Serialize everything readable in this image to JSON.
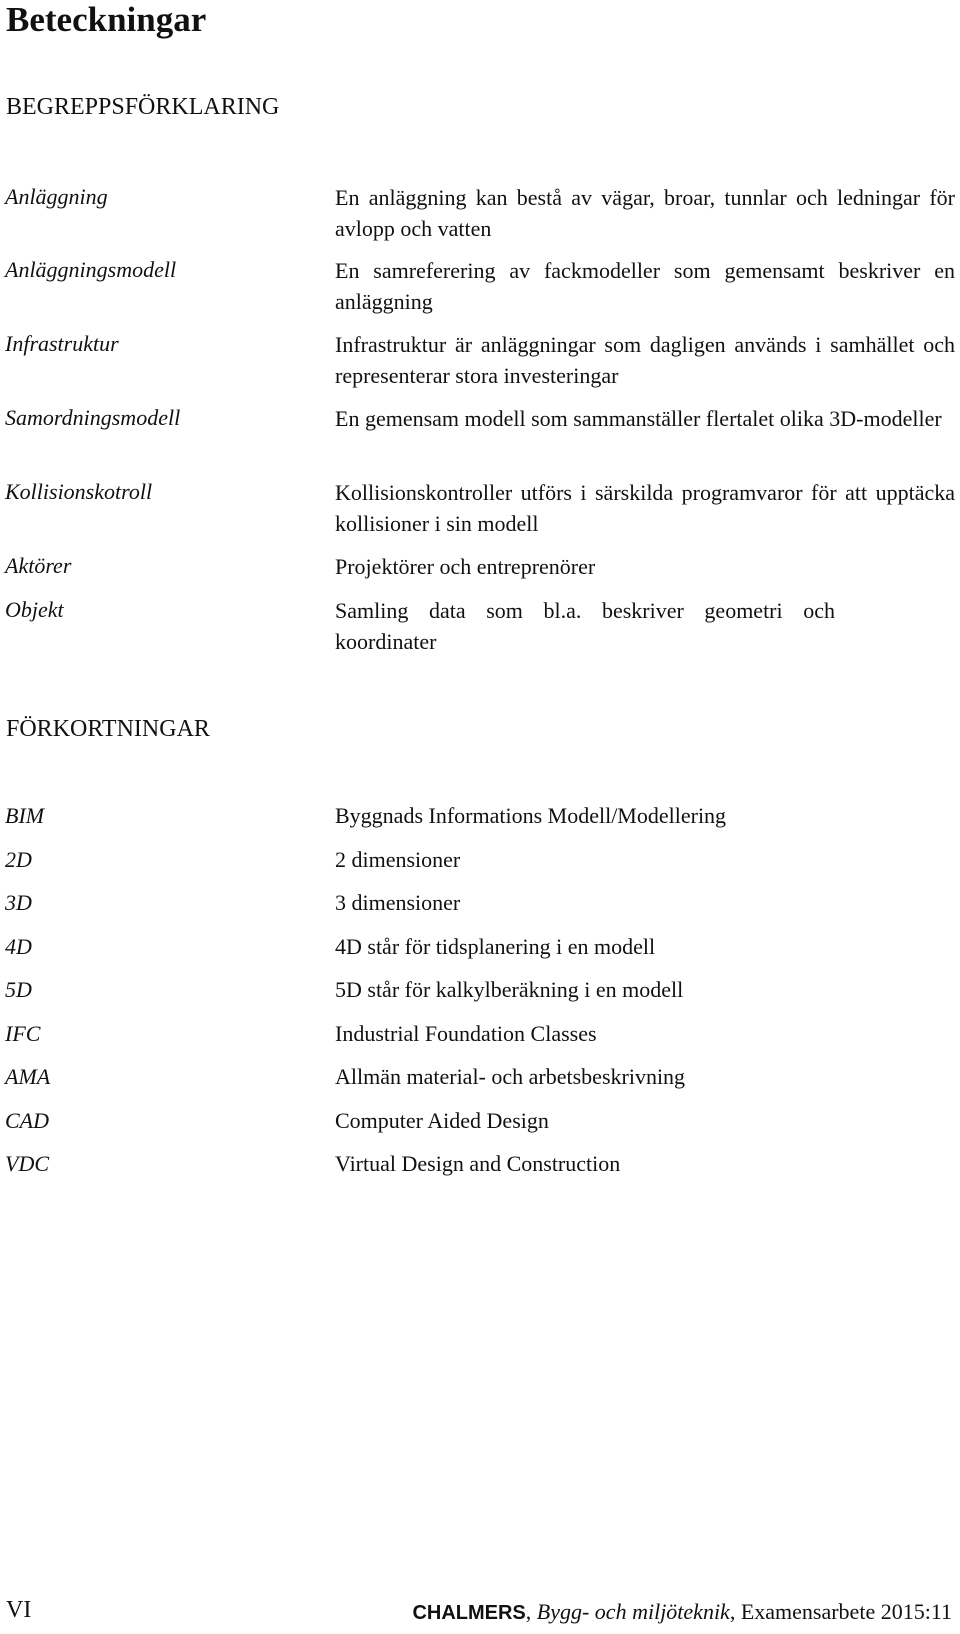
{
  "title": "Beteckningar",
  "definitions": {
    "heading": "BEGREPPSFÖRKLARING",
    "items": [
      {
        "term": "Anläggning",
        "description": "En anläggning kan bestå av vägar, broar, tunnlar och ledningar för avlopp och vatten"
      },
      {
        "term": "Anläggningsmodell",
        "description": "En samreferering av fackmodeller som gemensamt beskriver en anläggning"
      },
      {
        "term": "Infrastruktur",
        "description": "Infrastruktur är anläggningar som dagligen används i samhället och representerar stora investeringar"
      },
      {
        "term": "Samordningsmodell",
        "description": "En gemensam modell som sammanställer flertalet olika 3D-modeller"
      },
      {
        "term": "Kollisionskotroll",
        "description": "Kollisionskontroller utförs i särskilda programvaror för att upptäcka kollisioner i sin modell"
      },
      {
        "term": "Aktörer",
        "description": "Projektörer och entreprenörer"
      },
      {
        "term": "Objekt",
        "description": "Samling data som bl.a. beskriver geometri och koordinater"
      }
    ]
  },
  "abbreviations": {
    "heading": "FÖRKORTNINGAR",
    "items": [
      {
        "abbr": "BIM",
        "description": "Byggnads Informations Modell/Modellering"
      },
      {
        "abbr": "2D",
        "description": "2 dimensioner"
      },
      {
        "abbr": "3D",
        "description": "3 dimensioner"
      },
      {
        "abbr": "4D",
        "description": "4D står för tidsplanering i en modell"
      },
      {
        "abbr": "5D",
        "description": "5D står för kalkylberäkning i en modell"
      },
      {
        "abbr": "IFC",
        "description": "Industrial Foundation Classes"
      },
      {
        "abbr": "AMA",
        "description": "Allmän material- och arbetsbeskrivning"
      },
      {
        "abbr": "CAD",
        "description": "Computer Aided Design"
      },
      {
        "abbr": "VDC",
        "description": "Virtual Design and Construction"
      }
    ]
  },
  "footer": {
    "page_number": "VI",
    "brand": "CHALMERS",
    "separator": ", ",
    "department": "Bygg- och miljöteknik",
    "report": ", Examensarbete 2015:11"
  }
}
